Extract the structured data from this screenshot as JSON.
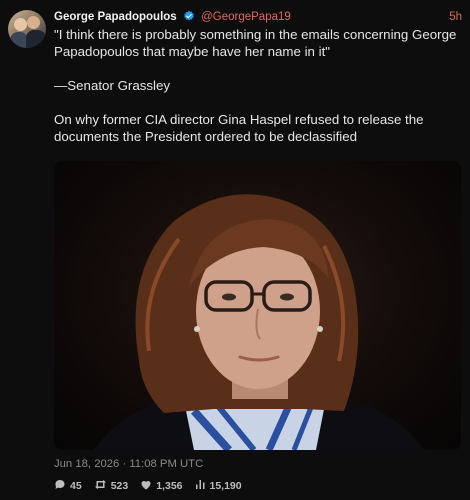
{
  "tweet": {
    "author_name": "George Papadopoulos",
    "author_handle": "@GeorgePapa19",
    "time_ago": "5h",
    "body_quote": "\"I think there is probably something in the emails concerning George Papadopoulos that maybe have her name in it\"",
    "body_attribution": "—Senator Grassley",
    "body_context": "On why former CIA director Gina Haspel refused to release the documents the President ordered to be declassified",
    "timestamp": "Jun 18, 2026 · 11:08 PM UTC",
    "stats": {
      "replies": "45",
      "retweets": "523",
      "likes": "1,356",
      "views": "15,190"
    }
  },
  "icons": {
    "verified": "verified-badge-icon",
    "reply": "reply-icon",
    "retweet": "retweet-icon",
    "like": "heart-icon",
    "views": "analytics-icon"
  },
  "colors": {
    "background": "#0d0d0d",
    "accent": "#e06a61",
    "verified": "#1d9bf0"
  }
}
